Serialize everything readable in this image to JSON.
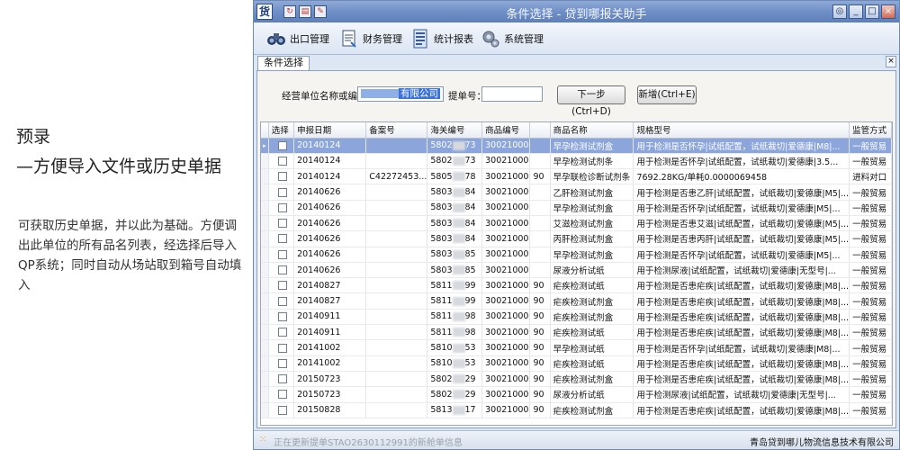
{
  "left": {
    "title_line1": "预录",
    "title_line2": "—方便导入文件或历史单据",
    "description": "可获取历史单据，并以此为基础。方便调出此单位的所有品名列表，经选择后导入QP系统；同时自动从场站取到箱号自动填入"
  },
  "window": {
    "title": "条件选择 - 贷到哪报关助手",
    "app_icon_text": "货",
    "buttons": {
      "minimize": "_",
      "maximize": "□",
      "close": "×",
      "extra": "◎"
    }
  },
  "menu": [
    {
      "label": "出口管理",
      "icon": "binoculars-icon"
    },
    {
      "label": "财务管理",
      "icon": "document-icon"
    },
    {
      "label": "统计报表",
      "icon": "report-icon"
    },
    {
      "label": "系统管理",
      "icon": "gear-icon"
    }
  ],
  "tab": {
    "label": "条件选择",
    "close": "×"
  },
  "form": {
    "company_label": "经营单位名称或编号：",
    "company_value": "有限公司",
    "bill_label": "提单号：",
    "bill_value": "",
    "next_button": "下一步(Ctrl+D)",
    "new_button": "新增(Ctrl+E)"
  },
  "grid": {
    "columns": [
      "选择",
      "申报日期",
      "备案号",
      "海关编号",
      "商品编号",
      "",
      "商品名称",
      "规格型号",
      "监管方式"
    ],
    "rows": [
      [
        "20140124",
        "",
        "5802",
        "73",
        "30021000",
        "",
        "早孕检测试剂盒",
        "用于检测是否怀孕|试纸配置，试纸裁切|爱德康|M8|...",
        "一般贸易"
      ],
      [
        "20140124",
        "",
        "5802",
        "73",
        "30021000",
        "",
        "早孕检测试剂条",
        "用于检测是否怀孕|试纸配置，试纸裁切|爱德康|3.5...",
        "一般贸易"
      ],
      [
        "20140124",
        "C42272453...",
        "5805",
        "78",
        "30021000",
        "90",
        "早孕联检诊断试剂条",
        "7692.28KG/单耗0.0000069458",
        "进料对口"
      ],
      [
        "20140626",
        "",
        "5803",
        "84",
        "30021000",
        "",
        "乙肝检测试剂盒",
        "用于检测是否患乙肝|试纸配置，试纸裁切|爱德康|M5|...",
        "一般贸易"
      ],
      [
        "20140626",
        "",
        "5803",
        "84",
        "30021000",
        "",
        "早孕检测试剂盒",
        "用于检测是否怀孕|试纸配置，试纸裁切|爱德康|M5|...",
        "一般贸易"
      ],
      [
        "20140626",
        "",
        "5803",
        "84",
        "30021000",
        "",
        "艾滋检测试剂盒",
        "用于检测是否患艾滋|试纸配置，试纸裁切|爱德康|M5|...",
        "一般贸易"
      ],
      [
        "20140626",
        "",
        "5803",
        "84",
        "30021000",
        "",
        "丙肝检测试剂盒",
        "用于检测是否患丙肝|试纸配置，试纸裁切|爱德康|M5|...",
        "一般贸易"
      ],
      [
        "20140626",
        "",
        "5803",
        "85",
        "30021000",
        "",
        "早孕检测试剂盒",
        "用于检测是否怀孕|试纸配置，试纸裁切|爱德康|M5|...",
        "一般贸易"
      ],
      [
        "20140626",
        "",
        "5803",
        "85",
        "30021000",
        "",
        "尿液分析试纸",
        "用于检测尿液|试纸配置，试纸裁切|爱德康|无型号|...",
        "一般贸易"
      ],
      [
        "20140827",
        "",
        "5811",
        "99",
        "30021000",
        "90",
        "疟疾检测试纸",
        "用于检测是否患疟疾|试纸配置，试纸裁切|爱德康|M8|...",
        "一般贸易"
      ],
      [
        "20140827",
        "",
        "5811",
        "99",
        "30021000",
        "90",
        "疟疾检测试剂盒",
        "用于检测是否患疟疾|试纸配置，试纸裁切|爱德康|M8|...",
        "一般贸易"
      ],
      [
        "20140911",
        "",
        "5811",
        "98",
        "30021000",
        "90",
        "疟疾检测试剂盒",
        "用于检测是否患疟疾|试纸配置，试纸裁切|爱德康|M8|...",
        "一般贸易"
      ],
      [
        "20140911",
        "",
        "5811",
        "98",
        "30021000",
        "90",
        "疟疾检测试纸",
        "用于检测是否患疟疾|试纸配置，试纸裁切|爱德康|M8|...",
        "一般贸易"
      ],
      [
        "20141002",
        "",
        "5810",
        "53",
        "30021000",
        "90",
        "早孕检测试纸",
        "用于检测是否怀孕|试纸配置，试纸裁切|爱德康|M8|...",
        "一般贸易"
      ],
      [
        "20141002",
        "",
        "5810",
        "53",
        "30021000",
        "90",
        "疟疾检测试纸",
        "用于检测是否患疟疾|试纸配置，试纸裁切|爱德康|M8|...",
        "一般贸易"
      ],
      [
        "20150723",
        "",
        "5802",
        "29",
        "30021000",
        "90",
        "疟疾检测试剂盒",
        "用于检测是否患疟疾|试纸配置，试纸裁切|爱德康|M8|...",
        "一般贸易"
      ],
      [
        "20150723",
        "",
        "5802",
        "29",
        "30021000",
        "90",
        "尿液分析试纸",
        "用于检测尿液|试纸配置，试纸裁切|爱德康|无型号|...",
        "一般贸易"
      ],
      [
        "20150828",
        "",
        "5813",
        "17",
        "30021000",
        "90",
        "疟疾检测试剂盒",
        "用于检测是否患疟疾|试纸配置，试纸裁切|爱德康|M8|...",
        "一般贸易"
      ]
    ]
  },
  "status": {
    "message": "正在更新提单STAO2630112991的新舱单信息",
    "company": "青岛贷到哪儿物流信息技术有限公司"
  }
}
